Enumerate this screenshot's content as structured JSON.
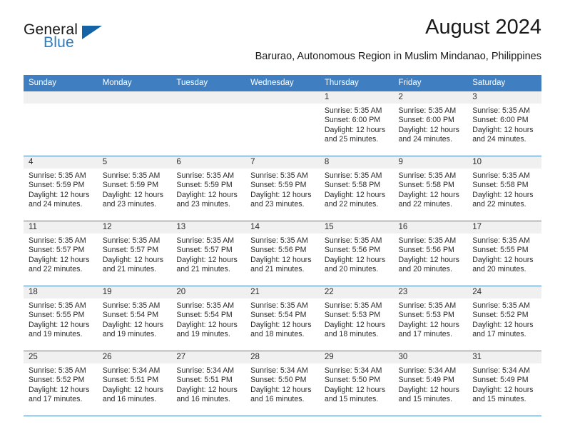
{
  "brand": {
    "word1": "General",
    "word2": "Blue",
    "logo_icon": "triangle-logo-icon",
    "color_dark": "#1a1a1a",
    "color_blue": "#2b7cc4",
    "triangle_color": "#1464a5"
  },
  "header": {
    "title": "August 2024",
    "subtitle": "Barurao, Autonomous Region in Muslim Mindanao, Philippines"
  },
  "theme": {
    "header_band": "#3f7fc1",
    "daynum_band": "#f0f0f0",
    "text": "#2b2b2b"
  },
  "calendar": {
    "weekday_headers": [
      "Sunday",
      "Monday",
      "Tuesday",
      "Wednesday",
      "Thursday",
      "Friday",
      "Saturday"
    ],
    "weeks": [
      [
        {
          "day": "",
          "empty": true,
          "lines": []
        },
        {
          "day": "",
          "empty": true,
          "lines": []
        },
        {
          "day": "",
          "empty": true,
          "lines": []
        },
        {
          "day": "",
          "empty": true,
          "lines": []
        },
        {
          "day": "1",
          "empty": false,
          "lines": [
            "Sunrise: 5:35 AM",
            "Sunset: 6:00 PM",
            "Daylight: 12 hours",
            "and 25 minutes."
          ]
        },
        {
          "day": "2",
          "empty": false,
          "lines": [
            "Sunrise: 5:35 AM",
            "Sunset: 6:00 PM",
            "Daylight: 12 hours",
            "and 24 minutes."
          ]
        },
        {
          "day": "3",
          "empty": false,
          "lines": [
            "Sunrise: 5:35 AM",
            "Sunset: 6:00 PM",
            "Daylight: 12 hours",
            "and 24 minutes."
          ]
        }
      ],
      [
        {
          "day": "4",
          "empty": false,
          "lines": [
            "Sunrise: 5:35 AM",
            "Sunset: 5:59 PM",
            "Daylight: 12 hours",
            "and 24 minutes."
          ]
        },
        {
          "day": "5",
          "empty": false,
          "lines": [
            "Sunrise: 5:35 AM",
            "Sunset: 5:59 PM",
            "Daylight: 12 hours",
            "and 23 minutes."
          ]
        },
        {
          "day": "6",
          "empty": false,
          "lines": [
            "Sunrise: 5:35 AM",
            "Sunset: 5:59 PM",
            "Daylight: 12 hours",
            "and 23 minutes."
          ]
        },
        {
          "day": "7",
          "empty": false,
          "lines": [
            "Sunrise: 5:35 AM",
            "Sunset: 5:59 PM",
            "Daylight: 12 hours",
            "and 23 minutes."
          ]
        },
        {
          "day": "8",
          "empty": false,
          "lines": [
            "Sunrise: 5:35 AM",
            "Sunset: 5:58 PM",
            "Daylight: 12 hours",
            "and 22 minutes."
          ]
        },
        {
          "day": "9",
          "empty": false,
          "lines": [
            "Sunrise: 5:35 AM",
            "Sunset: 5:58 PM",
            "Daylight: 12 hours",
            "and 22 minutes."
          ]
        },
        {
          "day": "10",
          "empty": false,
          "lines": [
            "Sunrise: 5:35 AM",
            "Sunset: 5:58 PM",
            "Daylight: 12 hours",
            "and 22 minutes."
          ]
        }
      ],
      [
        {
          "day": "11",
          "empty": false,
          "lines": [
            "Sunrise: 5:35 AM",
            "Sunset: 5:57 PM",
            "Daylight: 12 hours",
            "and 22 minutes."
          ]
        },
        {
          "day": "12",
          "empty": false,
          "lines": [
            "Sunrise: 5:35 AM",
            "Sunset: 5:57 PM",
            "Daylight: 12 hours",
            "and 21 minutes."
          ]
        },
        {
          "day": "13",
          "empty": false,
          "lines": [
            "Sunrise: 5:35 AM",
            "Sunset: 5:57 PM",
            "Daylight: 12 hours",
            "and 21 minutes."
          ]
        },
        {
          "day": "14",
          "empty": false,
          "lines": [
            "Sunrise: 5:35 AM",
            "Sunset: 5:56 PM",
            "Daylight: 12 hours",
            "and 21 minutes."
          ]
        },
        {
          "day": "15",
          "empty": false,
          "lines": [
            "Sunrise: 5:35 AM",
            "Sunset: 5:56 PM",
            "Daylight: 12 hours",
            "and 20 minutes."
          ]
        },
        {
          "day": "16",
          "empty": false,
          "lines": [
            "Sunrise: 5:35 AM",
            "Sunset: 5:56 PM",
            "Daylight: 12 hours",
            "and 20 minutes."
          ]
        },
        {
          "day": "17",
          "empty": false,
          "lines": [
            "Sunrise: 5:35 AM",
            "Sunset: 5:55 PM",
            "Daylight: 12 hours",
            "and 20 minutes."
          ]
        }
      ],
      [
        {
          "day": "18",
          "empty": false,
          "lines": [
            "Sunrise: 5:35 AM",
            "Sunset: 5:55 PM",
            "Daylight: 12 hours",
            "and 19 minutes."
          ]
        },
        {
          "day": "19",
          "empty": false,
          "lines": [
            "Sunrise: 5:35 AM",
            "Sunset: 5:54 PM",
            "Daylight: 12 hours",
            "and 19 minutes."
          ]
        },
        {
          "day": "20",
          "empty": false,
          "lines": [
            "Sunrise: 5:35 AM",
            "Sunset: 5:54 PM",
            "Daylight: 12 hours",
            "and 19 minutes."
          ]
        },
        {
          "day": "21",
          "empty": false,
          "lines": [
            "Sunrise: 5:35 AM",
            "Sunset: 5:54 PM",
            "Daylight: 12 hours",
            "and 18 minutes."
          ]
        },
        {
          "day": "22",
          "empty": false,
          "lines": [
            "Sunrise: 5:35 AM",
            "Sunset: 5:53 PM",
            "Daylight: 12 hours",
            "and 18 minutes."
          ]
        },
        {
          "day": "23",
          "empty": false,
          "lines": [
            "Sunrise: 5:35 AM",
            "Sunset: 5:53 PM",
            "Daylight: 12 hours",
            "and 17 minutes."
          ]
        },
        {
          "day": "24",
          "empty": false,
          "lines": [
            "Sunrise: 5:35 AM",
            "Sunset: 5:52 PM",
            "Daylight: 12 hours",
            "and 17 minutes."
          ]
        }
      ],
      [
        {
          "day": "25",
          "empty": false,
          "lines": [
            "Sunrise: 5:35 AM",
            "Sunset: 5:52 PM",
            "Daylight: 12 hours",
            "and 17 minutes."
          ]
        },
        {
          "day": "26",
          "empty": false,
          "lines": [
            "Sunrise: 5:34 AM",
            "Sunset: 5:51 PM",
            "Daylight: 12 hours",
            "and 16 minutes."
          ]
        },
        {
          "day": "27",
          "empty": false,
          "lines": [
            "Sunrise: 5:34 AM",
            "Sunset: 5:51 PM",
            "Daylight: 12 hours",
            "and 16 minutes."
          ]
        },
        {
          "day": "28",
          "empty": false,
          "lines": [
            "Sunrise: 5:34 AM",
            "Sunset: 5:50 PM",
            "Daylight: 12 hours",
            "and 16 minutes."
          ]
        },
        {
          "day": "29",
          "empty": false,
          "lines": [
            "Sunrise: 5:34 AM",
            "Sunset: 5:50 PM",
            "Daylight: 12 hours",
            "and 15 minutes."
          ]
        },
        {
          "day": "30",
          "empty": false,
          "lines": [
            "Sunrise: 5:34 AM",
            "Sunset: 5:49 PM",
            "Daylight: 12 hours",
            "and 15 minutes."
          ]
        },
        {
          "day": "31",
          "empty": false,
          "lines": [
            "Sunrise: 5:34 AM",
            "Sunset: 5:49 PM",
            "Daylight: 12 hours",
            "and 15 minutes."
          ]
        }
      ]
    ]
  }
}
